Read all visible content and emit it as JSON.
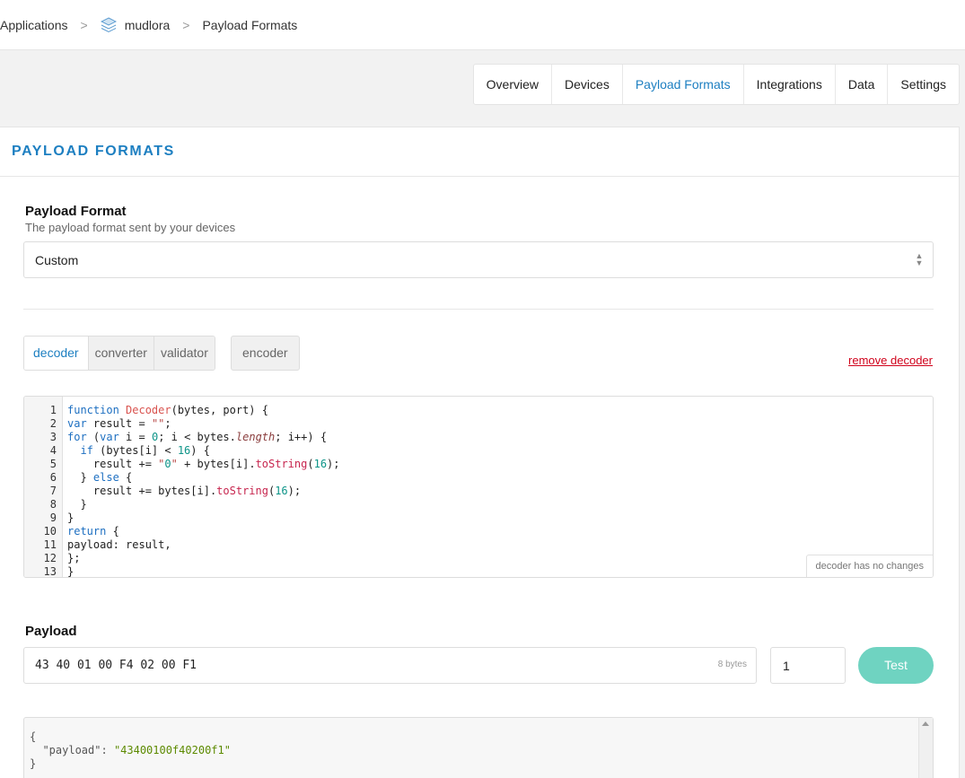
{
  "breadcrumb": {
    "root": "Applications",
    "separator": ">",
    "app": "mudlora",
    "current": "Payload Formats"
  },
  "tabs": [
    {
      "label": "Overview",
      "active": false
    },
    {
      "label": "Devices",
      "active": false
    },
    {
      "label": "Payload Formats",
      "active": true
    },
    {
      "label": "Integrations",
      "active": false
    },
    {
      "label": "Data",
      "active": false
    },
    {
      "label": "Settings",
      "active": false
    }
  ],
  "card": {
    "title": "PAYLOAD FORMATS"
  },
  "payload_format": {
    "label": "Payload Format",
    "description": "The payload format sent by your devices",
    "selected": "Custom"
  },
  "function_tabs": {
    "decoder": "decoder",
    "converter": "converter",
    "validator": "validator",
    "encoder": "encoder",
    "active": "decoder"
  },
  "remove_link": "remove decoder",
  "editor": {
    "status": "decoder has no changes",
    "lines": [
      "function Decoder(bytes, port) {",
      "var result = \"\";",
      "for (var i = 0; i < bytes.length; i++) {",
      "  if (bytes[i] < 16) {",
      "    result += \"0\" + bytes[i].toString(16);",
      "  } else {",
      "    result += bytes[i].toString(16);",
      "  }",
      "}",
      "return {",
      "payload: result,",
      "};",
      "}"
    ]
  },
  "payload": {
    "label": "Payload",
    "value": "43 40 01 00 F4 02 00 F1",
    "bytes": "8 bytes",
    "port": "1",
    "test_button": "Test"
  },
  "output": {
    "open": "{",
    "key": "\"payload\"",
    "colon": ": ",
    "value": "\"43400100f40200f1\"",
    "close": "}"
  },
  "colors": {
    "accent": "#1d7fc1",
    "danger": "#d0021b",
    "test_button": "#6fd3c1"
  }
}
